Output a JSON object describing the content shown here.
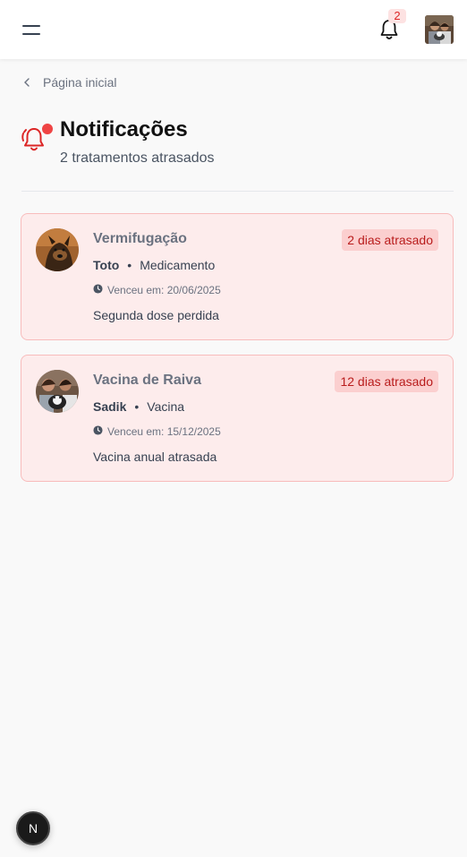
{
  "header": {
    "notification_count": "2"
  },
  "breadcrumb": {
    "label": "Página inicial"
  },
  "page": {
    "title": "Notificações",
    "subtitle": "2 tratamentos atrasados"
  },
  "notifications": [
    {
      "title": "Vermifugação",
      "badge": "2 dias atrasado",
      "pet": "Toto",
      "separator": "•",
      "type": "Medicamento",
      "due": "Venceu em: 20/06/2025",
      "note": "Segunda dose perdida"
    },
    {
      "title": "Vacina de Raiva",
      "badge": "12 dias atrasado",
      "pet": "Sadik",
      "separator": "•",
      "type": "Vacina",
      "due": "Venceu em: 15/12/2025",
      "note": "Vacina anual atrasada"
    }
  ],
  "dev_badge": {
    "label": "N"
  },
  "colors": {
    "accent_red": "#dc2626",
    "card_bg": "#fdecec",
    "card_border": "#f8bcbc"
  },
  "icons": [
    "menu-icon",
    "bell-icon",
    "chevron-left-icon",
    "bell-alert-icon",
    "clock-icon"
  ]
}
